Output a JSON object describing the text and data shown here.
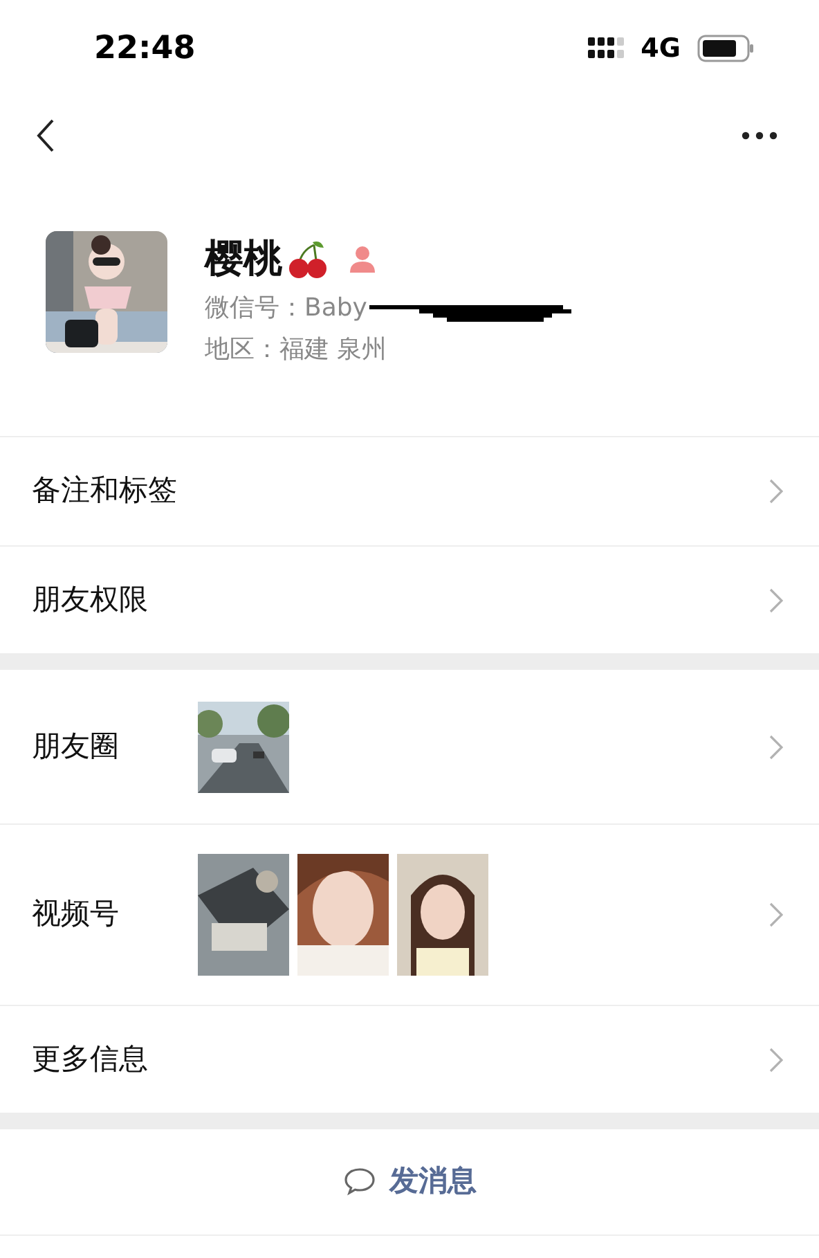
{
  "status_bar": {
    "time": "22:48",
    "network": "4G"
  },
  "profile": {
    "name": "樱桃",
    "wechat_id": "微信号：Baby",
    "region": "地区：福建 泉州"
  },
  "groups": [
    {
      "rows": [
        {
          "label": "备注和标签",
          "kind": "link"
        },
        {
          "label": "朋友权限",
          "kind": "link"
        }
      ]
    },
    {
      "rows": [
        {
          "label": "朋友圈",
          "kind": "photos"
        },
        {
          "label": "视频号",
          "kind": "photos"
        },
        {
          "label": "更多信息",
          "kind": "link"
        }
      ]
    }
  ],
  "actions": [
    {
      "label": "发消息"
    }
  ]
}
